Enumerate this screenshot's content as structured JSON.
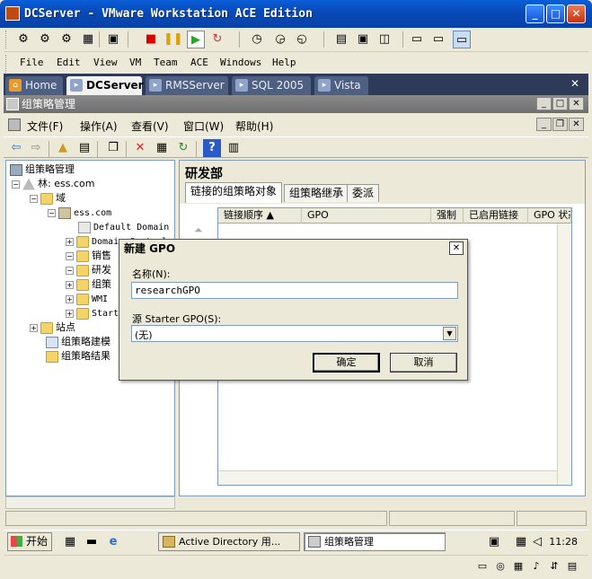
{
  "window": {
    "title": "DCServer - VMware Workstation ACE Edition",
    "minimize": "_",
    "maximize": "□",
    "close": "✕"
  },
  "menu": [
    "File",
    "Edit",
    "View",
    "VM",
    "Team",
    "ACE",
    "Windows",
    "Help"
  ],
  "tabs": [
    {
      "label": "Home",
      "icon": "home-icon",
      "active": false
    },
    {
      "label": "DCServer",
      "icon": "vm-icon",
      "active": true
    },
    {
      "label": "RMSServer",
      "icon": "vm-icon",
      "active": false
    },
    {
      "label": "SQL 2005",
      "icon": "vm-icon",
      "active": false
    },
    {
      "label": "Vista",
      "icon": "vm-icon",
      "active": false
    }
  ],
  "tab_close": "✕",
  "mmc": {
    "title": "组策略管理",
    "menu": [
      "文件(F)",
      "操作(A)",
      "查看(V)",
      "窗口(W)",
      "帮助(H)"
    ]
  },
  "tree": [
    {
      "label": "组策略管理",
      "indent": 0,
      "expander": "",
      "icon": "gpm-icon"
    },
    {
      "label": "林: ess.com",
      "indent": 1,
      "expander": "−",
      "icon": "forest-icon"
    },
    {
      "label": "域",
      "indent": 2,
      "expander": "−",
      "icon": "folder-icon"
    },
    {
      "label": "ess.com",
      "indent": 3,
      "expander": "−",
      "icon": "domain-icon"
    },
    {
      "label": "Default Domain",
      "indent": 4,
      "expander": "",
      "icon": "gpo-link-icon"
    },
    {
      "label": "Domain Control",
      "indent": 4,
      "expander": "+",
      "icon": "ou-icon"
    },
    {
      "label": "销售",
      "indent": 4,
      "expander": "−",
      "icon": "ou-icon"
    },
    {
      "label": "研发",
      "indent": 4,
      "expander": "−",
      "icon": "ou-icon"
    },
    {
      "label": "组策",
      "indent": 4,
      "expander": "+",
      "icon": "folder-icon"
    },
    {
      "label": "WMI",
      "indent": 4,
      "expander": "+",
      "icon": "folder-icon"
    },
    {
      "label": "Starter",
      "indent": 4,
      "expander": "+",
      "icon": "folder-icon"
    },
    {
      "label": "站点",
      "indent": 2,
      "expander": "+",
      "icon": "sites-icon"
    },
    {
      "label": "组策略建模",
      "indent": 2,
      "expander": "",
      "icon": "modeling-icon"
    },
    {
      "label": "组策略结果",
      "indent": 2,
      "expander": "",
      "icon": "results-icon"
    }
  ],
  "right_pane": {
    "title": "研发部",
    "tabs": [
      "链接的组策略对象",
      "组策略继承",
      "委派"
    ],
    "columns": [
      "链接顺序",
      "GPO",
      "强制",
      "已启用链接",
      "GPO 状态"
    ]
  },
  "dialog": {
    "title": "新建 GPO",
    "name_label": "名称(N):",
    "name_value": "researchGPO",
    "source_label": "源 Starter GPO(S):",
    "source_value": "(无)",
    "ok": "确定",
    "cancel": "取消"
  },
  "taskbar": {
    "start": "开始",
    "tasks": [
      {
        "label": "Active Directory 用...",
        "active": false
      },
      {
        "label": "组策略管理",
        "active": true
      }
    ],
    "clock": "11:28"
  }
}
